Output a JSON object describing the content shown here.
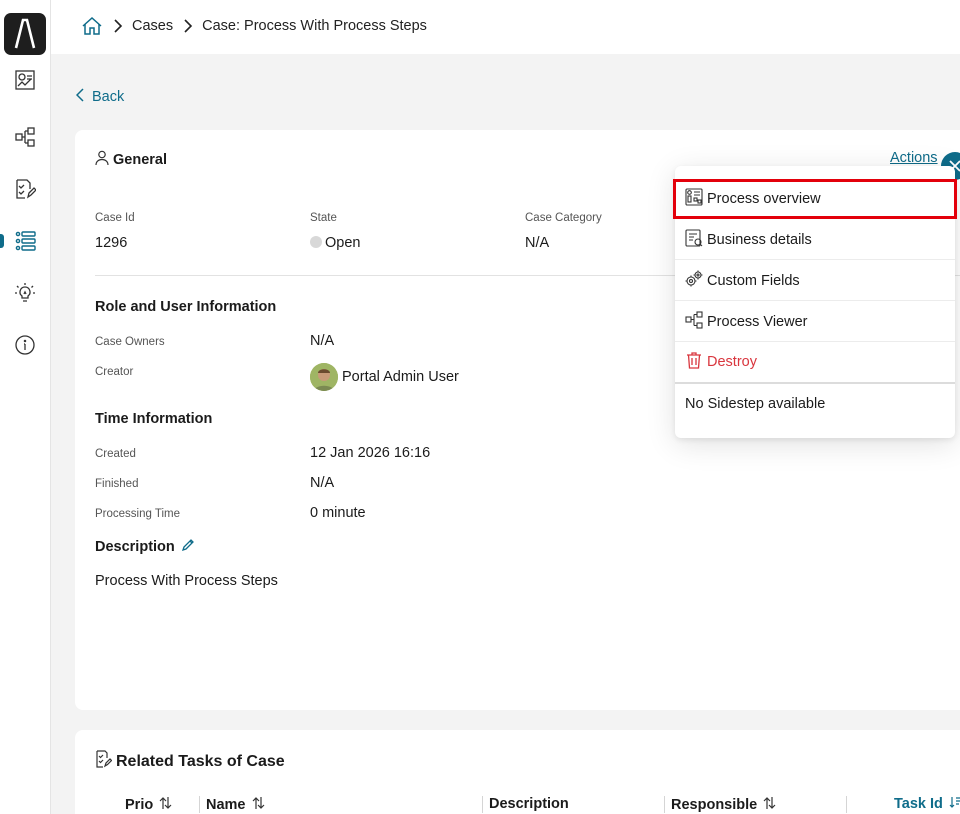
{
  "breadcrumb": {
    "items": [
      "Cases",
      "Case: Process With Process Steps"
    ]
  },
  "back_label": "Back",
  "general": {
    "title": "General",
    "actions_label": "Actions",
    "fields": {
      "case_id": {
        "label": "Case Id",
        "value": "1296"
      },
      "state": {
        "label": "State",
        "value": "Open"
      },
      "case_category": {
        "label": "Case Category",
        "value": "N/A"
      }
    },
    "role_section": {
      "title": "Role and User Information",
      "case_owners": {
        "label": "Case Owners",
        "value": "N/A"
      },
      "creator": {
        "label": "Creator",
        "value": "Portal Admin User"
      }
    },
    "time_section": {
      "title": "Time Information",
      "created": {
        "label": "Created",
        "value": "12 Jan 2026 16:16"
      },
      "finished": {
        "label": "Finished",
        "value": "N/A"
      },
      "processing_time": {
        "label": "Processing Time",
        "value": "0 minute"
      }
    },
    "description": {
      "title": "Description",
      "value": "Process With Process Steps"
    }
  },
  "actions_menu": {
    "items": [
      {
        "label": "Process overview",
        "icon": "process-overview-icon"
      },
      {
        "label": "Business details",
        "icon": "business-details-icon"
      },
      {
        "label": "Custom Fields",
        "icon": "gears-icon"
      },
      {
        "label": "Process Viewer",
        "icon": "process-viewer-icon"
      },
      {
        "label": "Destroy",
        "icon": "trash-icon"
      }
    ],
    "no_sidestep": "No Sidestep available"
  },
  "related_tasks": {
    "title": "Related Tasks of Case",
    "columns": [
      "Prio",
      "Name",
      "Description",
      "Responsible",
      "Task Id"
    ]
  },
  "colors": {
    "accent": "#0f6c8a",
    "danger": "#d9363e",
    "highlight": "#e3000b"
  }
}
